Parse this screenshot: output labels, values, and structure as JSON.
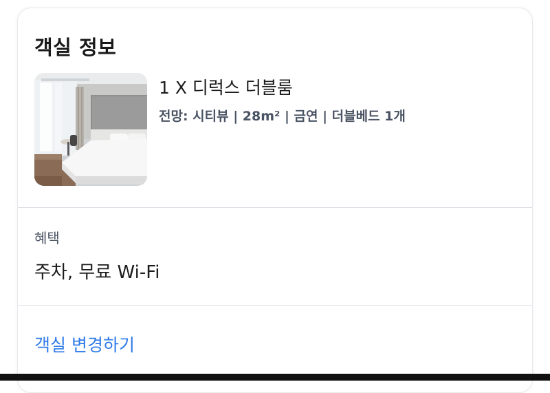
{
  "card": {
    "title": "객실 정보"
  },
  "room": {
    "name": "1 X 디럭스 더블룸",
    "details": "전망: 시티뷰 | 28m² | 금연 | 더블베드 1개",
    "photo_label": "room-photo"
  },
  "benefits": {
    "label": "혜택",
    "value": "주차, 무료 Wi-Fi"
  },
  "actions": {
    "change_room_label": "객실 변경하기"
  },
  "colors": {
    "link": "#2f7be8",
    "divider": "#dde1e7",
    "muted_text": "#4a5363"
  }
}
